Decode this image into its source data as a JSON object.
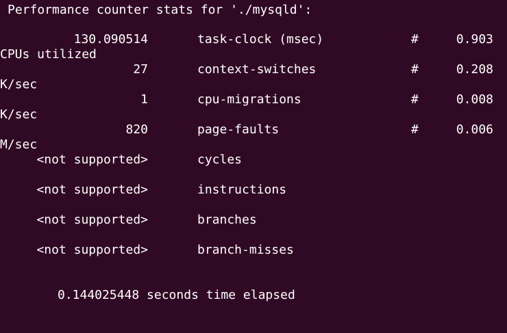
{
  "terminal": {
    "header": "Performance counter stats for './mysqld':",
    "stats": [
      {
        "value": "130.090514",
        "event": "task-clock (msec)",
        "hash": "#",
        "ratio": "0.903",
        "unit": "CPUs utilized"
      },
      {
        "value": "27",
        "event": "context-switches",
        "hash": "#",
        "ratio": "0.208",
        "unit": "K/sec"
      },
      {
        "value": "1",
        "event": "cpu-migrations",
        "hash": "#",
        "ratio": "0.008",
        "unit": "K/sec"
      },
      {
        "value": "820",
        "event": "page-faults",
        "hash": "#",
        "ratio": "0.006",
        "unit": "M/sec"
      },
      {
        "value": "<not supported>",
        "event": "cycles"
      },
      {
        "value": "<not supported>",
        "event": "instructions"
      },
      {
        "value": "<not supported>",
        "event": "branches"
      },
      {
        "value": "<not supported>",
        "event": "branch-misses"
      }
    ],
    "elapsed": "0.144025448 seconds time elapsed"
  }
}
